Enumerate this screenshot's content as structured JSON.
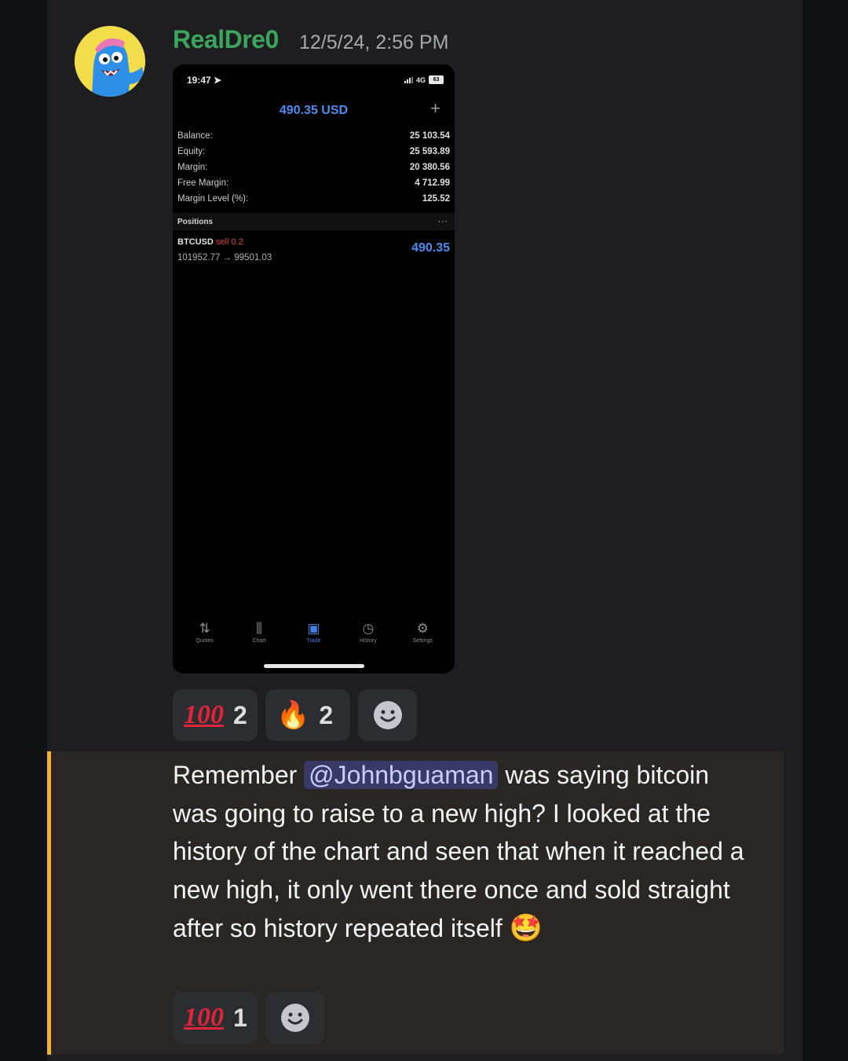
{
  "message": {
    "username": "RealDre0",
    "timestamp": "12/5/24, 2:56 PM",
    "text_part1": "Remember ",
    "mention": "@Johnbguaman",
    "text_part2": " was saying bitcoin was going to raise to a new high? I looked at the history of the chart and seen that when it reached a new high, it only went there once and sold straight after so history repeated itself",
    "inline_emoji": "🤩"
  },
  "phone_screenshot": {
    "status_time": "19:47 ➤",
    "network": "4G",
    "battery": "63",
    "profit_title": "490.35 USD",
    "plus_icon": "+",
    "account": {
      "balance_label": "Balance:",
      "balance_value": "25 103.54",
      "equity_label": "Equity:",
      "equity_value": "25 593.89",
      "margin_label": "Margin:",
      "margin_value": "20 380.56",
      "free_margin_label": "Free Margin:",
      "free_margin_value": "4 712.99",
      "margin_level_label": "Margin Level (%):",
      "margin_level_value": "125.52"
    },
    "positions_label": "Positions",
    "more_icon": "···",
    "position": {
      "symbol": "BTCUSD",
      "side": "sell 0.2",
      "prices": "101952.77 → 99501.03",
      "profit": "490.35"
    },
    "nav": [
      {
        "label": "Quotes",
        "icon": "⇅"
      },
      {
        "label": "Chart",
        "icon": "⫼"
      },
      {
        "label": "Trade",
        "icon": "▣"
      },
      {
        "label": "History",
        "icon": "◷"
      },
      {
        "label": "Settings",
        "icon": "⚙"
      }
    ]
  },
  "reactions_top": [
    {
      "emoji": "100",
      "count": "2"
    },
    {
      "emoji": "🔥",
      "count": "2"
    }
  ],
  "reactions_bottom": [
    {
      "emoji": "100",
      "count": "1"
    }
  ],
  "add_reaction_icon": "☻",
  "colors": {
    "username": "#3ba55c",
    "mention_bg": "#3c4270",
    "highlight_bar": "#f0b232",
    "profit_blue": "#4a8df2",
    "sell_red": "#e0453a"
  }
}
